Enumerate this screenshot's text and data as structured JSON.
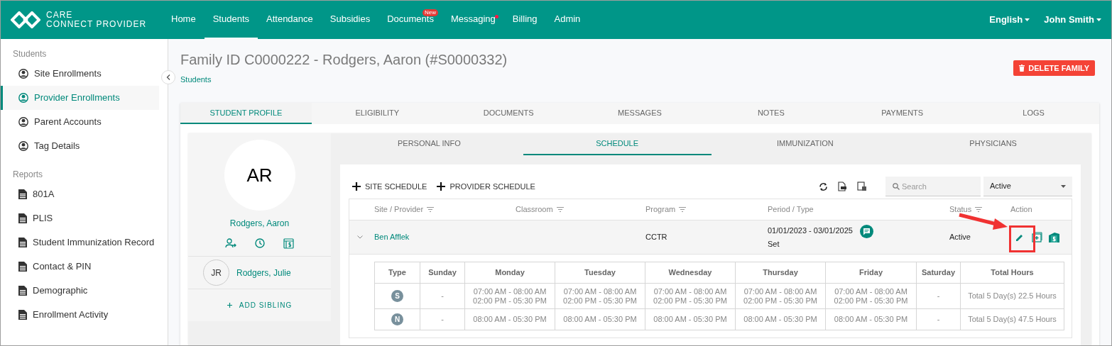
{
  "header": {
    "logo": {
      "line_1": "CARE",
      "line_2": "CONNECT PROVIDER"
    },
    "nav": [
      {
        "label": "Home",
        "selected": false,
        "dot": false
      },
      {
        "label": "Students",
        "selected": true,
        "dot": false
      },
      {
        "label": "Attendance",
        "selected": false,
        "dot": false
      },
      {
        "label": "Subsidies",
        "selected": false,
        "dot": false
      },
      {
        "label": "Documents",
        "selected": false,
        "dot": false,
        "badge": "New"
      },
      {
        "label": "Messaging",
        "selected": false,
        "dot": true
      },
      {
        "label": "Billing",
        "selected": false,
        "dot": false
      },
      {
        "label": "Admin",
        "selected": false,
        "dot": false
      }
    ],
    "language": "English",
    "user": "John Smith"
  },
  "sidebar": {
    "sections": [
      {
        "title": "Students",
        "items": [
          {
            "label": "Site Enrollments",
            "kind": "person",
            "selected": false
          },
          {
            "label": "Provider Enrollments",
            "kind": "person",
            "selected": true
          },
          {
            "label": "Parent Accounts",
            "kind": "person",
            "selected": false
          },
          {
            "label": "Tag Details",
            "kind": "person",
            "selected": false
          }
        ]
      },
      {
        "title": "Reports",
        "items": [
          {
            "label": "801A",
            "kind": "report",
            "selected": false
          },
          {
            "label": "PLIS",
            "kind": "report",
            "selected": false
          },
          {
            "label": "Student Immunization Record",
            "kind": "report",
            "selected": false
          },
          {
            "label": "Contact & PIN",
            "kind": "report",
            "selected": false
          },
          {
            "label": "Demographic",
            "kind": "report",
            "selected": false
          },
          {
            "label": "Enrollment Activity",
            "kind": "report",
            "selected": false
          }
        ]
      }
    ]
  },
  "page": {
    "title": "Family ID C0000222 - Rodgers, Aaron (#S0000332)",
    "breadcrumb": "Students",
    "delete_button": "DELETE FAMILY"
  },
  "tabs": [
    {
      "label": "STUDENT PROFILE",
      "selected": true
    },
    {
      "label": "ELIGIBILITY",
      "selected": false
    },
    {
      "label": "DOCUMENTS",
      "selected": false
    },
    {
      "label": "MESSAGES",
      "selected": false
    },
    {
      "label": "NOTES",
      "selected": false
    },
    {
      "label": "PAYMENTS",
      "selected": false
    },
    {
      "label": "LOGS",
      "selected": false
    }
  ],
  "profile": {
    "initials": "AR",
    "name": "Rodgers, Aaron",
    "siblings": [
      {
        "initials": "JR",
        "name": "Rodgers, Julie"
      }
    ],
    "add_sibling": "ADD SIBLING"
  },
  "subtabs": [
    {
      "label": "PERSONAL INFO",
      "selected": false
    },
    {
      "label": "SCHEDULE",
      "selected": true
    },
    {
      "label": "IMMUNIZATION",
      "selected": false
    },
    {
      "label": "PHYSICIANS",
      "selected": false
    }
  ],
  "schedule": {
    "actions": [
      "SITE SCHEDULE",
      "PROVIDER SCHEDULE"
    ],
    "search": {
      "placeholder": "Search"
    },
    "status_filter": "Active",
    "columns": [
      {
        "label": "Site / Provider",
        "filterable": true
      },
      {
        "label": "Classroom",
        "filterable": true
      },
      {
        "label": "Program",
        "filterable": true
      },
      {
        "label": "Period / Type",
        "filterable": false
      },
      {
        "label": "Status",
        "filterable": true
      },
      {
        "label": "Action",
        "filterable": false
      }
    ],
    "rows": [
      {
        "site_provider": "Ben Afflek",
        "program": "CCTR",
        "period": "01/01/2023 - 03/01/2025",
        "type": "Set",
        "status": "Active",
        "expanded": true,
        "details": {
          "columns": [
            "Type",
            "Sunday",
            "Monday",
            "Tuesday",
            "Wednesday",
            "Thursday",
            "Friday",
            "Saturday",
            "Total Hours"
          ],
          "rows": [
            {
              "cells": [
                {
                  "kind": "badge",
                  "text": "S"
                },
                {
                  "kind": "text",
                  "lines": [
                    "-"
                  ]
                },
                {
                  "kind": "text",
                  "lines": [
                    "07:00 AM - 08:00 AM",
                    "02:00 PM - 05:30 PM"
                  ]
                },
                {
                  "kind": "text",
                  "lines": [
                    "07:00 AM - 08:00 AM",
                    "02:00 PM - 05:30 PM"
                  ]
                },
                {
                  "kind": "text",
                  "lines": [
                    "07:00 AM - 08:00 AM",
                    "02:00 PM - 05:30 PM"
                  ]
                },
                {
                  "kind": "text",
                  "lines": [
                    "07:00 AM - 08:00 AM",
                    "02:00 PM - 05:30 PM"
                  ]
                },
                {
                  "kind": "text",
                  "lines": [
                    "07:00 AM - 08:00 AM",
                    "02:00 PM - 05:30 PM"
                  ]
                },
                {
                  "kind": "text",
                  "lines": [
                    "-"
                  ]
                },
                {
                  "kind": "text",
                  "lines": [
                    "Total 5 Day(s) 22.5 Hours"
                  ]
                }
              ]
            },
            {
              "cells": [
                {
                  "kind": "badge",
                  "text": "N"
                },
                {
                  "kind": "text",
                  "lines": [
                    "-"
                  ]
                },
                {
                  "kind": "text",
                  "lines": [
                    "08:00 AM - 05:30 PM"
                  ]
                },
                {
                  "kind": "text",
                  "lines": [
                    "08:00 AM - 05:30 PM"
                  ]
                },
                {
                  "kind": "text",
                  "lines": [
                    "08:00 AM - 05:30 PM"
                  ]
                },
                {
                  "kind": "text",
                  "lines": [
                    "08:00 AM - 05:30 PM"
                  ]
                },
                {
                  "kind": "text",
                  "lines": [
                    "08:00 AM - 05:30 PM"
                  ]
                },
                {
                  "kind": "text",
                  "lines": [
                    "-"
                  ]
                },
                {
                  "kind": "text",
                  "lines": [
                    "Total 5 Day(s) 47.5 Hours"
                  ]
                }
              ]
            }
          ]
        }
      }
    ]
  }
}
